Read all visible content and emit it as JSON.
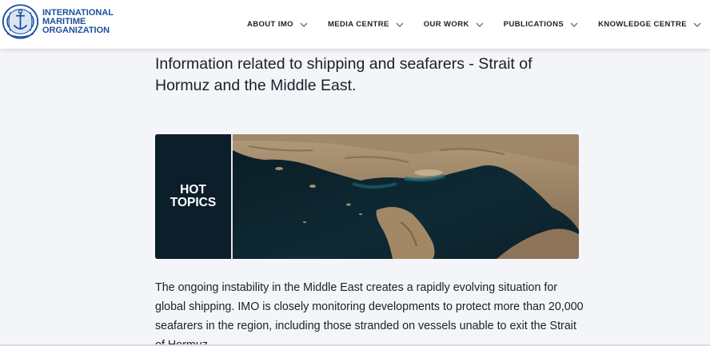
{
  "header": {
    "logo_lines": [
      "INTERNATIONAL",
      "MARITIME",
      "ORGANIZATION"
    ],
    "nav": [
      {
        "label": "ABOUT IMO"
      },
      {
        "label": "MEDIA CENTRE"
      },
      {
        "label": "OUR WORK"
      },
      {
        "label": "PUBLICATIONS"
      },
      {
        "label": "KNOWLEDGE CENTRE"
      }
    ]
  },
  "main": {
    "title": "Information related to shipping and seafarers - Strait of Hormuz and the Middle East.",
    "banner": {
      "label_line1": "HOT",
      "label_line2": "TOPICS"
    },
    "intro": "The ongoing instability in the Middle East creates a rapidly evolving situation for global shipping. IMO is closely monitoring developments to protect more than 20,000 seafarers in the region, including those stranded on vessels unable to exit the Strait of Hormuz."
  },
  "colors": {
    "brand_blue": "#1b4f9c",
    "text": "#1b1f2a",
    "background": "#f4f5f9",
    "banner_dark": "#0d1e2b"
  }
}
